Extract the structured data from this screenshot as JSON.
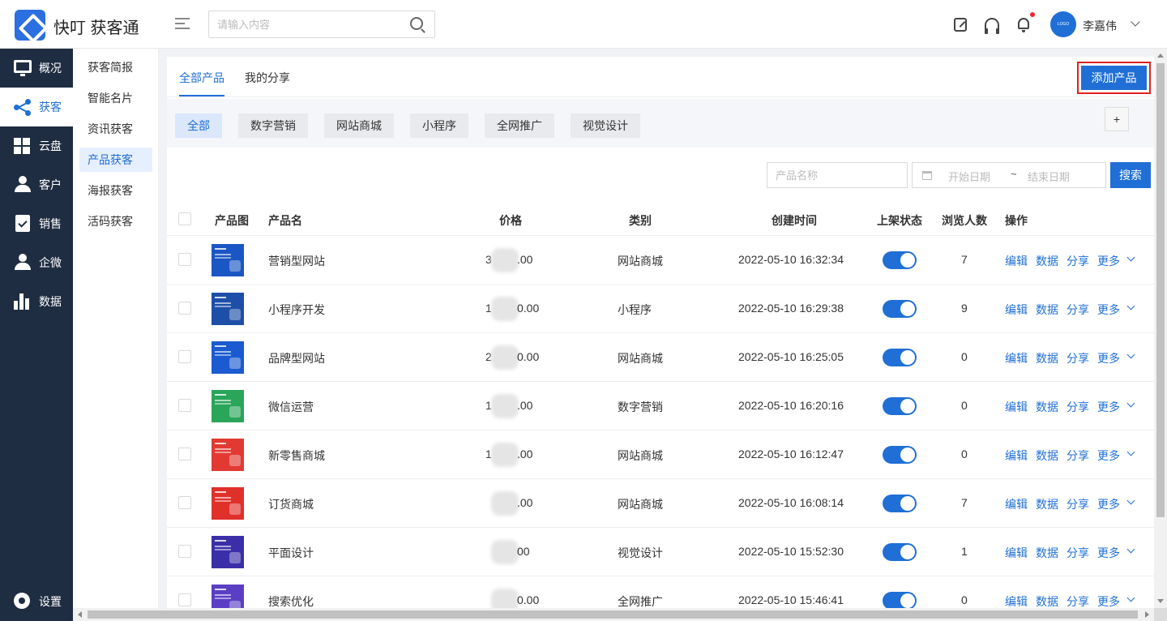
{
  "app": {
    "brand": "快叮 获客通",
    "search_placeholder": "请输入内容",
    "avatar_text": "LOGO",
    "user_name": "李嘉伟"
  },
  "nav": [
    {
      "id": "overview",
      "label": "概况",
      "icon": "monitor-icon"
    },
    {
      "id": "acquire",
      "label": "获客",
      "icon": "share-icon",
      "active": true
    },
    {
      "id": "cloud",
      "label": "云盘",
      "icon": "grid-icon"
    },
    {
      "id": "customer",
      "label": "客户",
      "icon": "user-icon"
    },
    {
      "id": "sales",
      "label": "销售",
      "icon": "clipboard-check-icon"
    },
    {
      "id": "wecom",
      "label": "企微",
      "icon": "person-icon"
    },
    {
      "id": "data",
      "label": "数据",
      "icon": "bar-chart-icon"
    }
  ],
  "settings_label": "设置",
  "submenu": [
    "获客简报",
    "智能名片",
    "资讯获客",
    "产品获客",
    "海报获客",
    "活码获客"
  ],
  "submenu_active": "产品获客",
  "tabs": [
    "全部产品",
    "我的分享"
  ],
  "add_button": "添加产品",
  "categories": [
    "全部",
    "数字营销",
    "网站商城",
    "小程序",
    "全网推广",
    "视觉设计"
  ],
  "plus_label": "+",
  "filters": {
    "name_placeholder": "产品名称",
    "start_placeholder": "开始日期",
    "separator": "~",
    "end_placeholder": "结束日期",
    "search_button": "搜索"
  },
  "columns": [
    "产品图",
    "产品名",
    "价格",
    "类别",
    "创建时间",
    "上架状态",
    "浏览人数",
    "操作"
  ],
  "actions": [
    "编辑",
    "数据",
    "分享",
    "更多"
  ],
  "rows": [
    {
      "name": "营销型网站",
      "price_prefix": "3",
      "price_suffix": ".00",
      "category": "网站商城",
      "created": "2022-05-10 16:32:34",
      "views": "7",
      "thumb_color": "#1a56c4",
      "on": true
    },
    {
      "name": "小程序开发",
      "price_prefix": "1",
      "price_suffix": "0.00",
      "category": "小程序",
      "created": "2022-05-10 16:29:38",
      "views": "9",
      "thumb_color": "#1e4fa8",
      "on": true
    },
    {
      "name": "品牌型网站",
      "price_prefix": "2",
      "price_suffix": "0.00",
      "category": "网站商城",
      "created": "2022-05-10 16:25:05",
      "views": "0",
      "thumb_color": "#1b5ad0",
      "on": true
    },
    {
      "name": "微信运营",
      "price_prefix": "1",
      "price_suffix": ".00",
      "category": "数字营销",
      "created": "2022-05-10 16:20:16",
      "views": "0",
      "thumb_color": "#2aa55a",
      "on": true
    },
    {
      "name": "新零售商城",
      "price_prefix": "1",
      "price_suffix": ".00",
      "category": "网站商城",
      "created": "2022-05-10 16:12:47",
      "views": "0",
      "thumb_color": "#e23a32",
      "on": true
    },
    {
      "name": "订货商城",
      "price_prefix": "",
      "price_suffix": ".00",
      "category": "网站商城",
      "created": "2022-05-10 16:08:14",
      "views": "7",
      "thumb_color": "#e0302a",
      "on": true
    },
    {
      "name": "平面设计",
      "price_prefix": "",
      "price_suffix": "00",
      "category": "视觉设计",
      "created": "2022-05-10 15:52:30",
      "views": "1",
      "thumb_color": "#3a2fa8",
      "on": true
    },
    {
      "name": "搜索优化",
      "price_prefix": "",
      "price_suffix": "0.00",
      "category": "全网推广",
      "created": "2022-05-10 15:46:41",
      "views": "0",
      "thumb_color": "#5a3fc4",
      "on": true
    }
  ]
}
